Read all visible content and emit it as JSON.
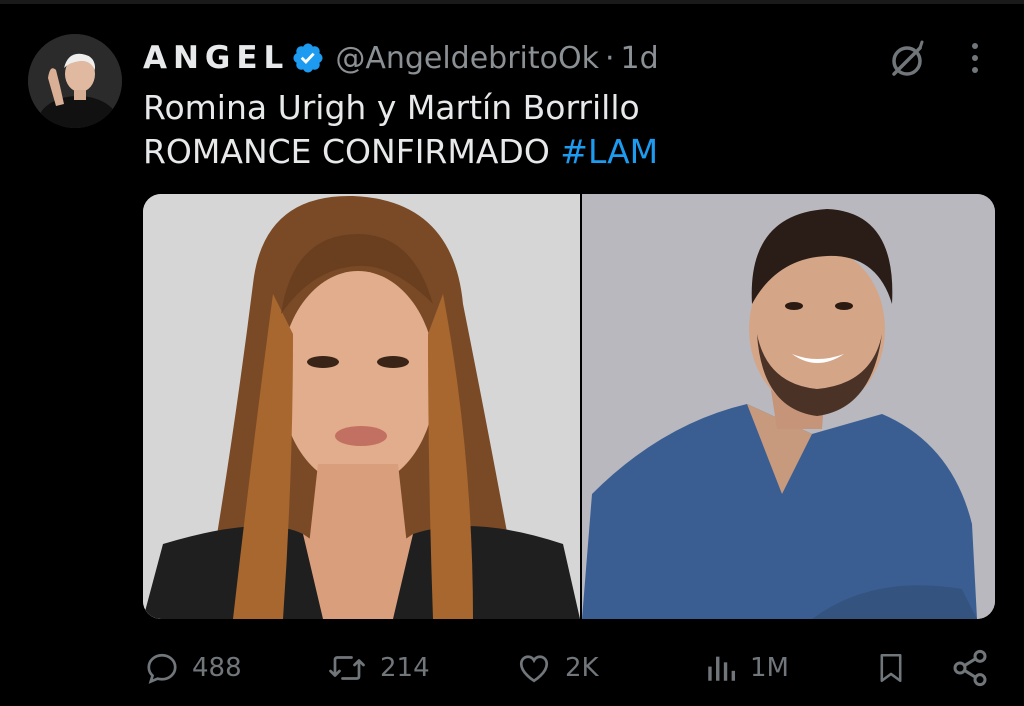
{
  "tweet": {
    "display_name": "ANGEL",
    "handle": "@AngeldebritoOk",
    "separator": "·",
    "time": "1d",
    "text_line1": "Romina Urigh y Martín Borrillo",
    "text_line2": "ROMANCE CONFIRMADO",
    "hashtag": "#LAM"
  },
  "actions": {
    "replies": "488",
    "retweets": "214",
    "likes": "2K",
    "views": "1M"
  },
  "icons": {
    "verified": "verified-badge-icon",
    "grok": "grok-icon",
    "more": "more-vertical-icon",
    "reply": "reply-icon",
    "retweet": "retweet-icon",
    "like": "heart-icon",
    "views": "views-chart-icon",
    "bookmark": "bookmark-icon",
    "share": "share-icon"
  },
  "colors": {
    "background": "#000000",
    "text": "#e7e9ea",
    "secondary": "#71767b",
    "accent": "#1d9bf0"
  }
}
